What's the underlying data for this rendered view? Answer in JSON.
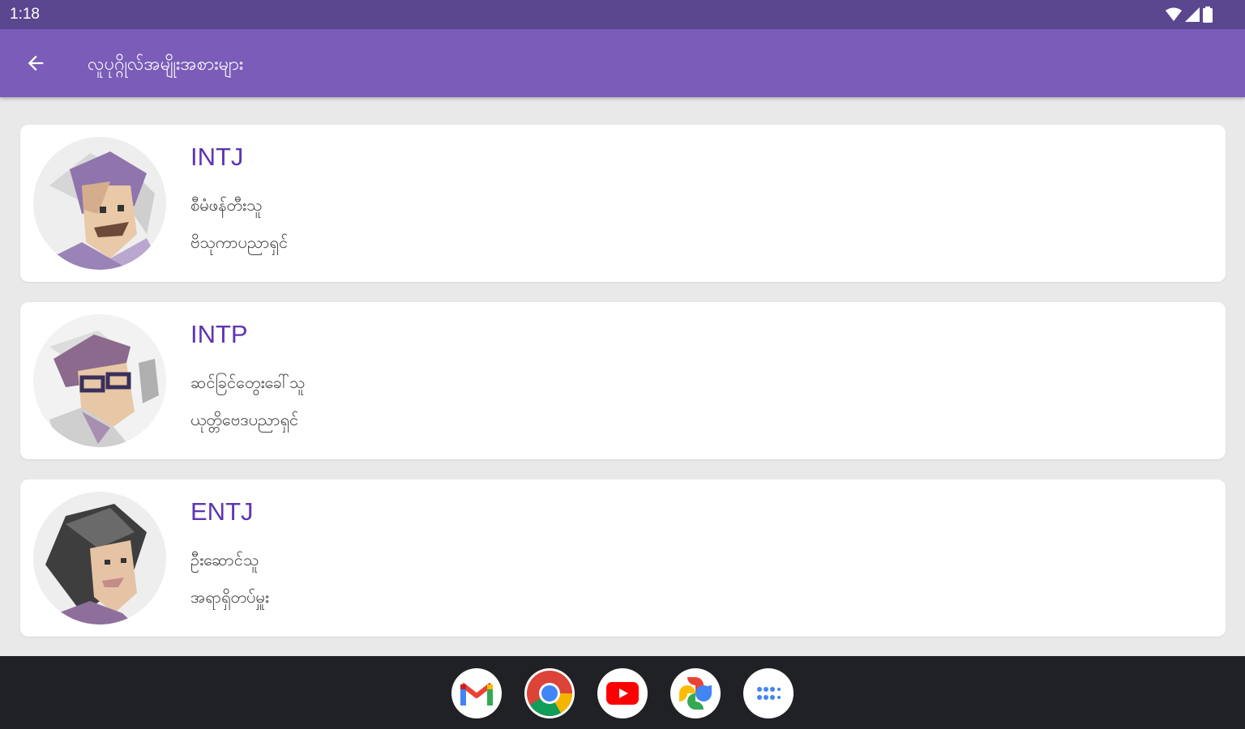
{
  "status_bar": {
    "time": "1:18"
  },
  "app_bar": {
    "title": "လူပုဂ္ဂိုလ်အမျိုးအစားများ"
  },
  "types": [
    {
      "code": "INTJ",
      "line1": "စီမံဖန်တီးသူ",
      "line2": "ဗိသုကာပညာရှင်"
    },
    {
      "code": "INTP",
      "line1": "ဆင်ခြင်တွေးခေါ်သူ",
      "line2": "ယုတ္တိဗေဒပညာရှင်"
    },
    {
      "code": "ENTJ",
      "line1": "ဦးဆောင်သူ",
      "line2": "အရာရှိတပ်မှူး"
    }
  ],
  "dock": {
    "apps": [
      "gmail-icon",
      "chrome-icon",
      "youtube-icon",
      "photos-icon",
      "app-drawer-icon"
    ]
  },
  "colors": {
    "status_bar": "#5b478f",
    "app_bar": "#7b5cb8",
    "accent_text": "#5e35b1",
    "background": "#e9e9e9",
    "nav_bar": "#202124"
  }
}
